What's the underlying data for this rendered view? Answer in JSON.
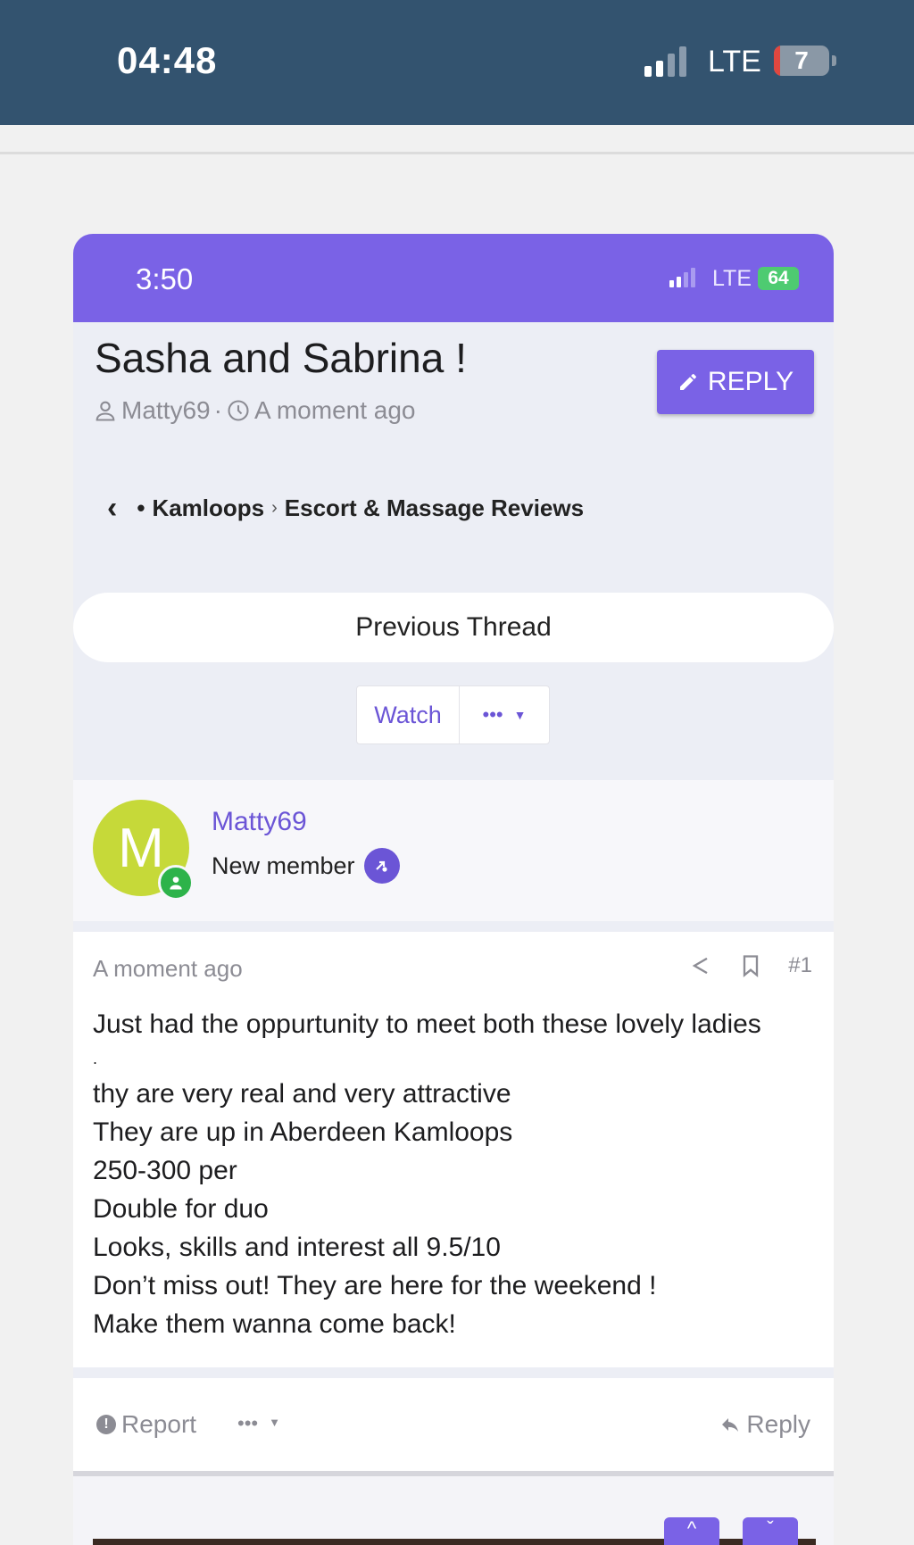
{
  "outer_status": {
    "time": "04:48",
    "network": "LTE",
    "battery": "7"
  },
  "inner_status": {
    "time": "3:50",
    "network": "LTE",
    "battery": "64"
  },
  "thread": {
    "title": "Sasha and Sabrina !",
    "author": "Matty69",
    "separator": "·",
    "time": "A moment ago",
    "reply_label": "REPLY"
  },
  "breadcrumb": {
    "bullet": "•",
    "items": [
      "Kamloops",
      "Escort & Massage Reviews"
    ],
    "separator": "›"
  },
  "nav": {
    "previous_thread": "Previous Thread",
    "watch": "Watch",
    "more": "•••"
  },
  "post": {
    "avatar_letter": "M",
    "author": "Matty69",
    "role": "New member",
    "time": "A moment ago",
    "number": "#1",
    "lines": [
      "Just had the oppurtunity to meet both these lovely ladies",
      ".",
      "thy are very real and very attractive",
      "They are up in Aberdeen Kamloops",
      "250-300 per",
      "Double for duo",
      "Looks, skills and interest all 9.5/10",
      "Don’t miss out! They are here for the weekend !",
      "Make them wanna come back!"
    ]
  },
  "footer": {
    "report": "Report",
    "more": "•••",
    "reply": "Reply"
  },
  "colors": {
    "accent": "#7a62e6",
    "outer_status_bg": "#33536f",
    "avatar_bg": "#c6d939"
  }
}
